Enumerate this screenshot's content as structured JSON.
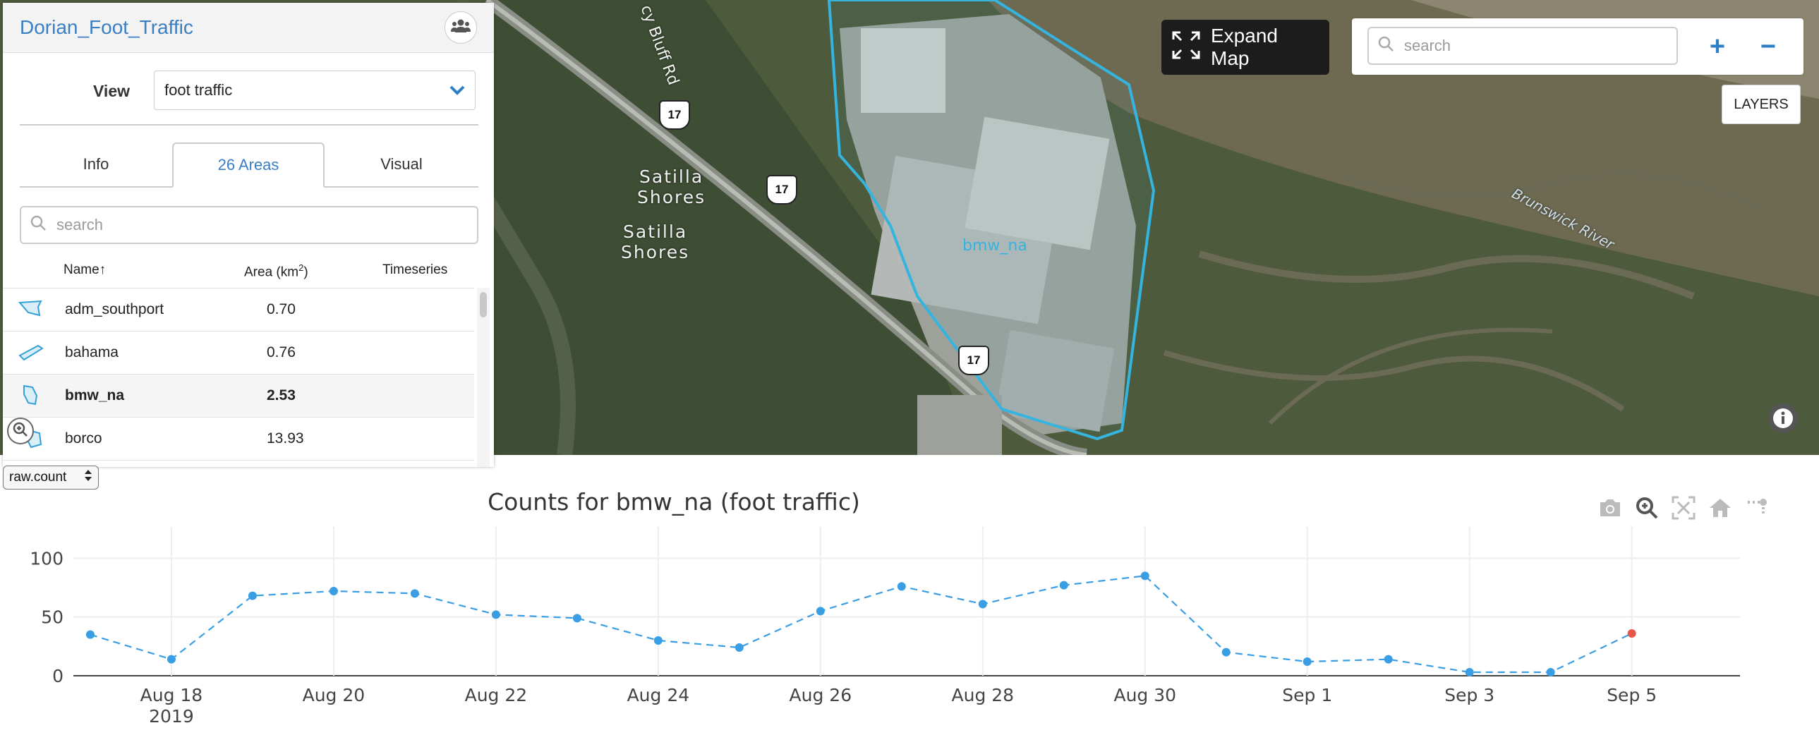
{
  "map": {
    "labels": {
      "road": "cy Bluff Rd",
      "place1": "Satilla\nShores",
      "place2": "Satilla\nShores",
      "river": "Brunswick River",
      "polygon": "bmw_na",
      "shield": "17"
    },
    "expand_label": "Expand Map",
    "search_placeholder": "search",
    "zoom_in": "+",
    "zoom_out": "−",
    "layers_label": "LAYERS",
    "polygon_color": "#35b4e0"
  },
  "panel": {
    "title": "Dorian_Foot_Traffic",
    "view_label": "View",
    "view_value": "foot traffic",
    "tabs": [
      {
        "label": "Info"
      },
      {
        "label": "26 Areas"
      },
      {
        "label": "Visual"
      }
    ],
    "active_tab": "26 Areas",
    "search_placeholder": "search",
    "columns": {
      "name": "Name↑",
      "area": "Area (km",
      "area_sup": "2",
      "area_close": ")",
      "timeseries": "Timeseries"
    },
    "rows": [
      {
        "name": "adm_southport",
        "area": "0.70"
      },
      {
        "name": "bahama",
        "area": "0.76"
      },
      {
        "name": "bmw_na",
        "area": "2.53"
      },
      {
        "name": "borco",
        "area": "13.93"
      }
    ],
    "selected_row": "bmw_na"
  },
  "metric_select": {
    "value": "raw.count"
  },
  "chart_data": {
    "type": "line",
    "title": "Counts for bmw_na (foot traffic)",
    "xlabel": "",
    "ylabel": "",
    "x": [
      "2019-08-17",
      "2019-08-18",
      "2019-08-19",
      "2019-08-20",
      "2019-08-21",
      "2019-08-22",
      "2019-08-23",
      "2019-08-24",
      "2019-08-25",
      "2019-08-26",
      "2019-08-27",
      "2019-08-28",
      "2019-08-29",
      "2019-08-30",
      "2019-08-31",
      "2019-09-01",
      "2019-09-02",
      "2019-09-03",
      "2019-09-04",
      "2019-09-05"
    ],
    "series": [
      {
        "values": [
          35,
          14,
          68,
          72,
          70,
          52,
          49,
          30,
          24,
          55,
          76,
          61,
          77,
          85,
          20,
          12,
          14,
          3,
          3,
          36
        ],
        "color": "#3a9ee4",
        "highlight_color": "#e8584a",
        "highlight_index": 19
      }
    ],
    "x_ticks": [
      "Aug 18",
      "Aug 20",
      "Aug 22",
      "Aug 24",
      "Aug 26",
      "Aug 28",
      "Aug 30",
      "Sep 1",
      "Sep 3",
      "Sep 5"
    ],
    "x_tick_year": "2019",
    "y_ticks": [
      "0",
      "50",
      "100"
    ],
    "ylim": [
      0,
      100
    ],
    "grid": true,
    "line_style": "dashed"
  }
}
